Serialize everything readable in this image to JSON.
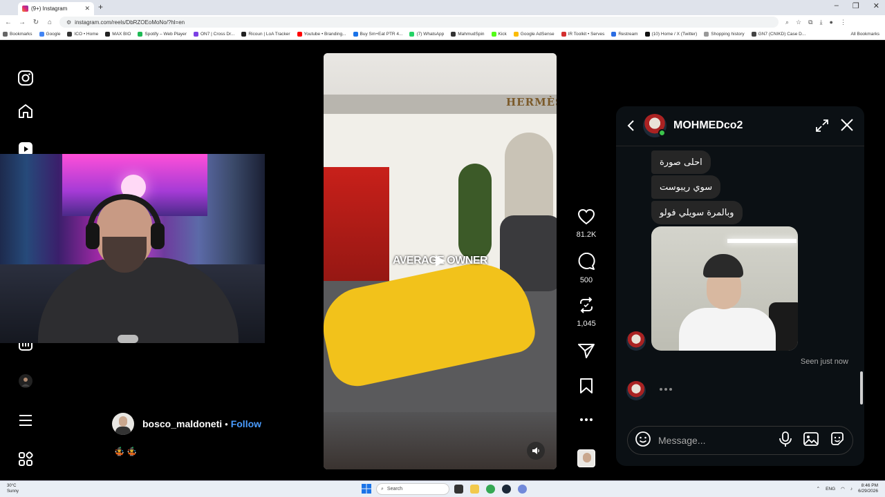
{
  "browser": {
    "tab_title": "(9+) Instagram",
    "new_tab": "+",
    "url": "instagram.com/reels/DbRZOEoMoNo/?hl=en",
    "window_controls": [
      "–",
      "❐",
      "✕"
    ],
    "bookmarks": [
      "Bookmarks",
      "Google",
      "ICO • Home",
      "MAX BIO",
      "Spotify – Web Player",
      "ON7 | Cross Dr...",
      "Ricoun | LoA Tracker",
      "Youtube • Branding...",
      "Buy Sm+Eat PTR 4...",
      "(7) WhatsApp",
      "MahmudSpin",
      "Kick",
      "Google AdSense",
      "IR Toolkit • Serves",
      "Restream",
      "(10) Home / X (Twitter)",
      "Shopping history",
      "GN7 (CNIKD) Case D..."
    ],
    "all_bookmarks": "All Bookmarks"
  },
  "reel": {
    "caption": "AVERAGE   OWNER",
    "store_sign": "HERMÈS",
    "likes": "81.2K",
    "comments": "500",
    "reposts": "1,045"
  },
  "author": {
    "username": "bosco_maldoneti",
    "separator": "•",
    "follow_label": "Follow",
    "emojis": "🤹 🤹"
  },
  "dm": {
    "contact_name": "MOHMEDco2",
    "messages": [
      "احلى صورة",
      "سوي ريبوست",
      "وبالمرة سويلي فولو"
    ],
    "seen_status": "Seen just now",
    "composer_placeholder": "Message..."
  },
  "taskbar": {
    "weather_temp": "30°C",
    "weather_desc": "Sunny",
    "search_placeholder": "Search",
    "lang": "ENG",
    "time": "8:46 PM",
    "date": "6/29/2026"
  },
  "colors": {
    "follow": "#4a9cff",
    "online": "#3cc34b",
    "bubble": "#262626",
    "panel": "#0b1014"
  }
}
